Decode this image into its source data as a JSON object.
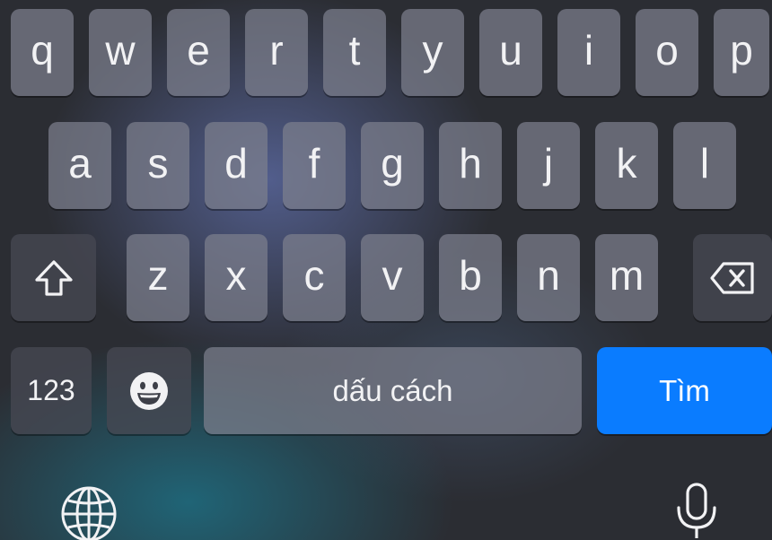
{
  "keyboard": {
    "row1": [
      "q",
      "w",
      "e",
      "r",
      "t",
      "y",
      "u",
      "i",
      "o",
      "p"
    ],
    "row2": [
      "a",
      "s",
      "d",
      "f",
      "g",
      "h",
      "j",
      "k",
      "l"
    ],
    "row3": [
      "z",
      "x",
      "c",
      "v",
      "b",
      "n",
      "m"
    ],
    "mode_label": "123",
    "space_label": "dấu cách",
    "return_label": "Tìm",
    "icons": {
      "shift": "shift-icon",
      "delete": "delete-icon",
      "emoji": "emoji-icon",
      "globe": "globe-icon",
      "dictation": "microphone-icon"
    },
    "colors": {
      "return_key": "#0a7cff"
    }
  }
}
